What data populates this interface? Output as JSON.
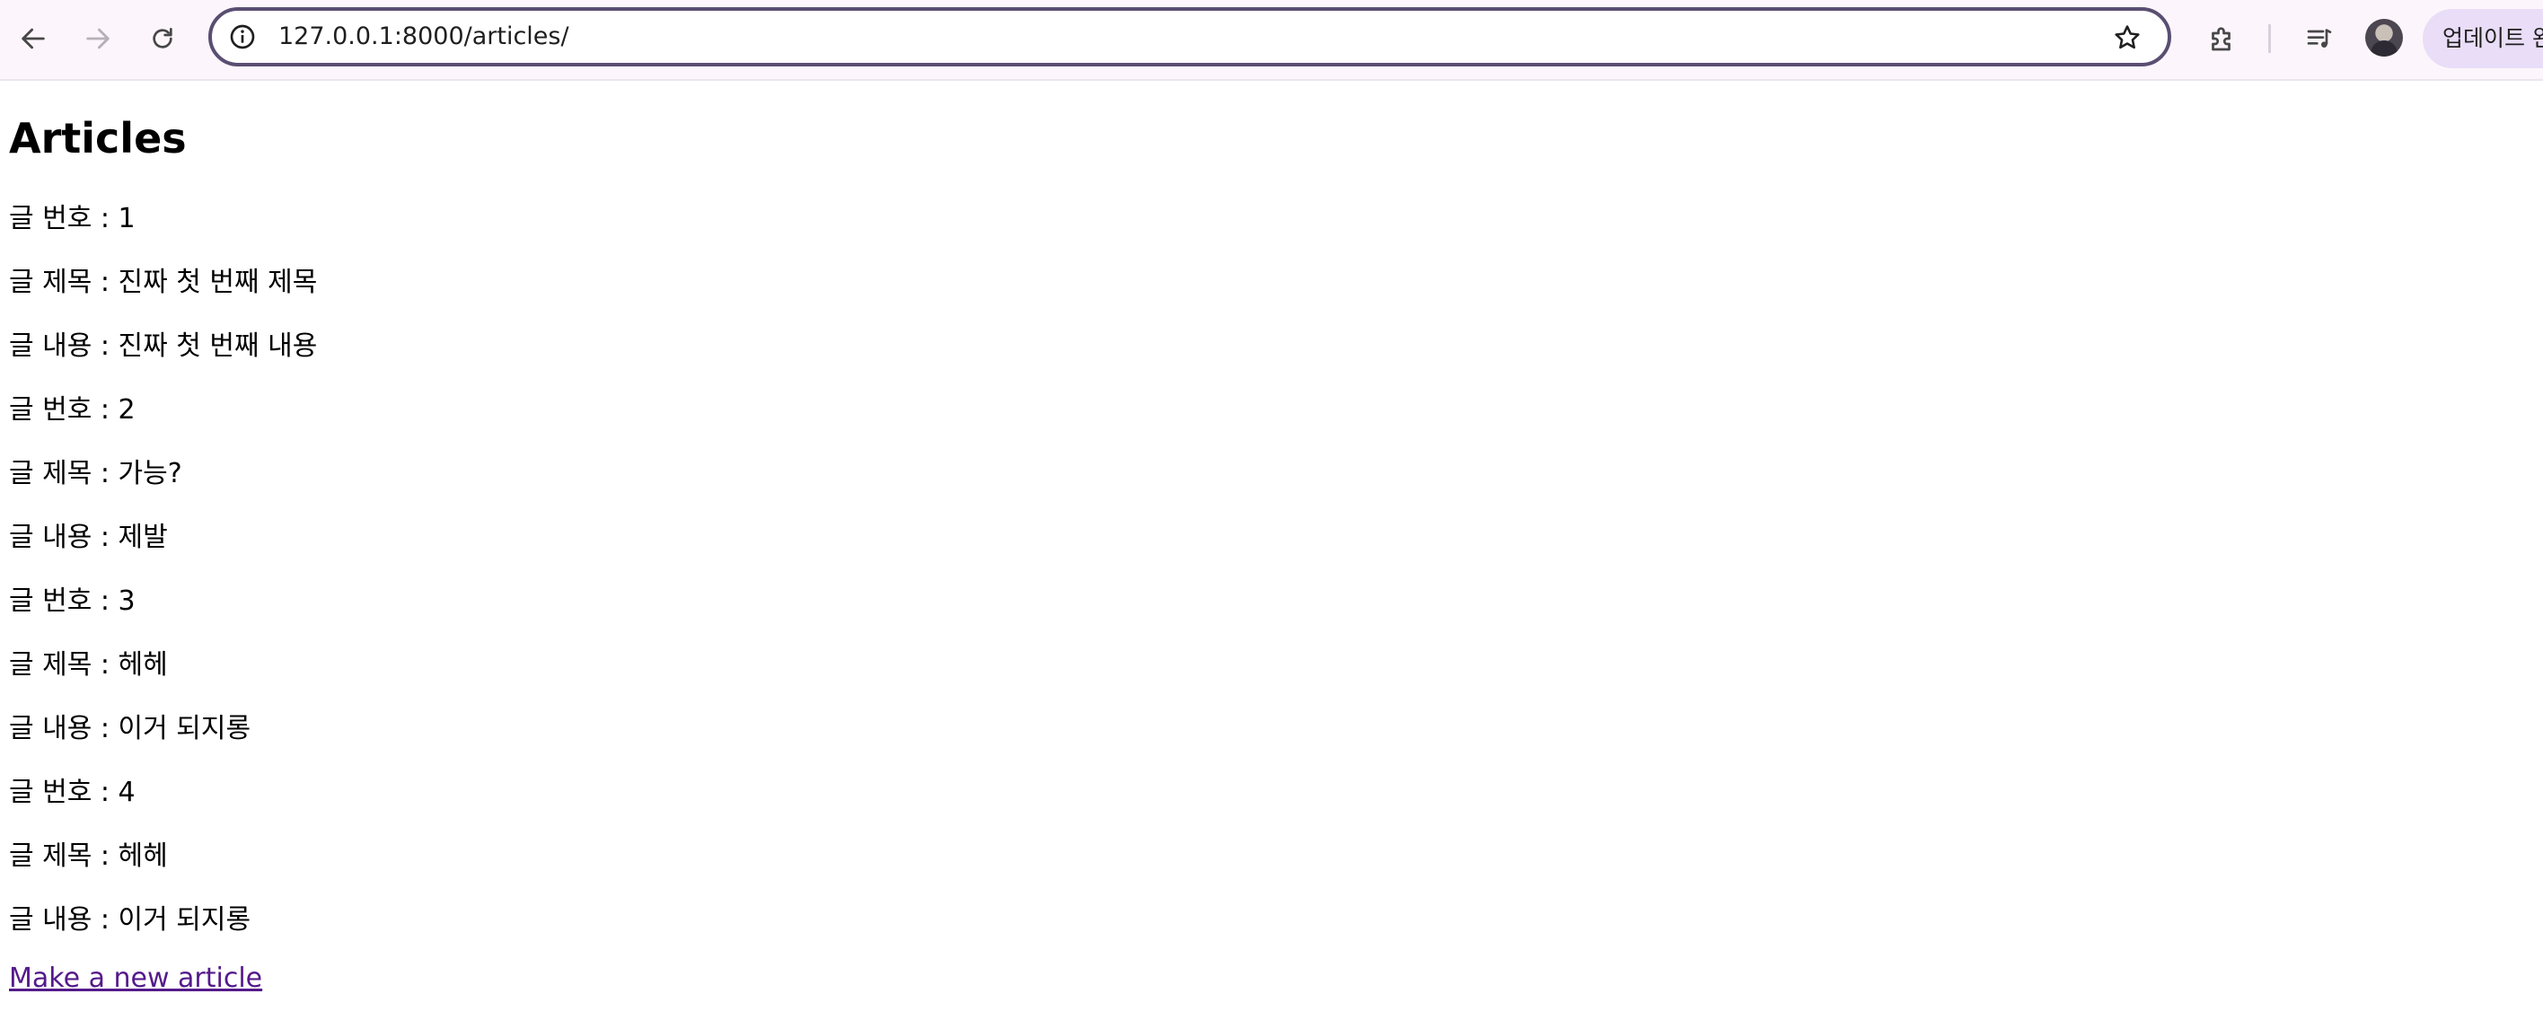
{
  "browser": {
    "url": "127.0.0.1:8000/articles/",
    "update_label": "업데이트 완"
  },
  "page": {
    "title": "Articles",
    "articles": [
      {
        "id_line": "글 번호 : 1",
        "title_line": "글 제목 : 진짜 첫 번째 제목",
        "content_line": "글 내용 : 진짜 첫 번째 내용"
      },
      {
        "id_line": "글 번호 : 2",
        "title_line": "글 제목 : 가능?",
        "content_line": "글 내용 : 제발"
      },
      {
        "id_line": "글 번호 : 3",
        "title_line": "글 제목 : 헤헤",
        "content_line": "글 내용 : 이거 되지롱"
      },
      {
        "id_line": "글 번호 : 4",
        "title_line": "글 제목 : 헤헤",
        "content_line": "글 내용 : 이거 되지롱"
      }
    ],
    "new_article_link": "Make a new article"
  },
  "icons": {
    "back": "arrow-left-icon",
    "forward": "arrow-right-icon",
    "reload": "reload-icon",
    "site_info": "info-icon",
    "bookmark": "star-icon",
    "extensions": "puzzle-icon",
    "media": "media-queue-icon",
    "profile": "avatar"
  },
  "colors": {
    "toolbar_bg": "#fcf6fc",
    "omnibox_border": "#5a4e72",
    "update_button_bg": "#e9ddf7",
    "visited_link": "#551a8b"
  }
}
